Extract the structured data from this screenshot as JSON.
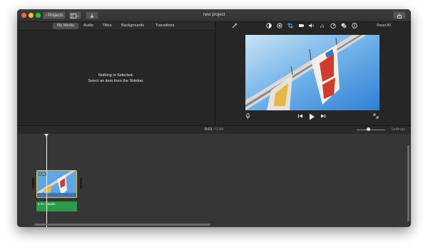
{
  "window": {
    "title": "new project",
    "controls": [
      "close",
      "minimize",
      "zoom"
    ],
    "colors": {
      "close": "#fc5f57",
      "minimize": "#fdbc2e",
      "zoom": "#28c840"
    }
  },
  "toolbar": {
    "projects_label": "Projects",
    "projects_icon": "chevron-left-icon",
    "media_toggle_icon": "media-browser-icon",
    "import_icon": "import-arrow-icon",
    "share_icon": "share-icon"
  },
  "browser": {
    "tabs": [
      {
        "label": "My Media",
        "active": true
      },
      {
        "label": "Audio",
        "active": false
      },
      {
        "label": "Titles",
        "active": false
      },
      {
        "label": "Backgrounds",
        "active": false
      },
      {
        "label": "Transitions",
        "active": false
      }
    ],
    "empty_line1": "Nothing Is Selected.",
    "empty_line2": "Select an item from the Sidebar."
  },
  "viewer": {
    "tools": [
      "magic-wand-icon",
      "color-balance-icon",
      "color-correction-icon",
      "crop-icon",
      "stabilization-icon",
      "volume-icon",
      "noise-reduction-icon",
      "speed-icon",
      "clip-filter-icon",
      "info-icon"
    ],
    "reset_label": "Reset All",
    "controls": [
      "microphone-icon",
      "skip-back-icon",
      "play-icon",
      "skip-forward-icon",
      "fullscreen-icon"
    ]
  },
  "timeline": {
    "current_time": "0:01",
    "separator": "/",
    "total_time": "0:04",
    "settings_label": "Settings",
    "zoom_level": 0.45,
    "clip": {
      "label": "4.7s"
    },
    "audio": {
      "label": "4.7s – audio"
    },
    "music_icon": "music-note-icon"
  },
  "accent": {
    "time_current": "#e8e8e8",
    "time_total": "#8a8a8a",
    "clip_border": "#e8c14a",
    "audio_clip": "#2b9a48"
  }
}
